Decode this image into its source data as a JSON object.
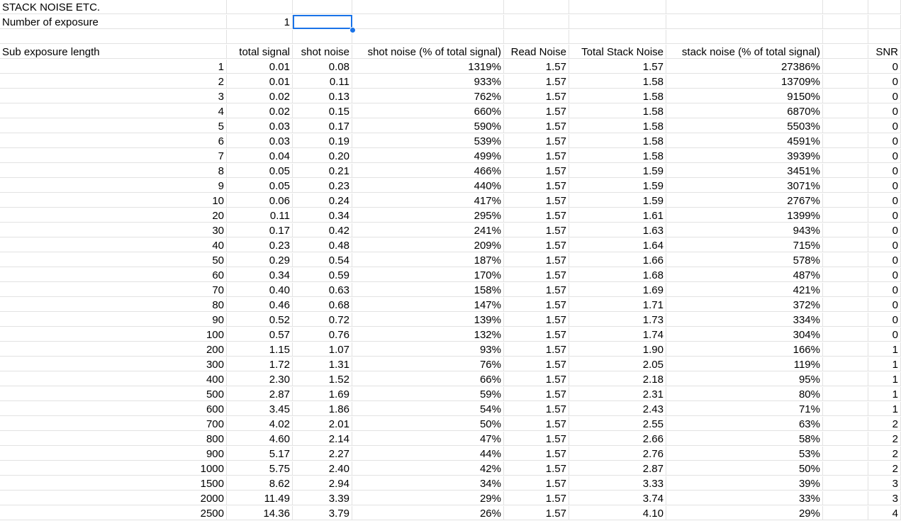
{
  "sheet": {
    "title": "STACK NOISE ETC.",
    "exposure_label": "Number of exposure",
    "exposure_value": "1",
    "selected_cell_value": "",
    "headers": {
      "sub_exposure_length": "Sub exposure length",
      "total_signal": "total signal",
      "shot_noise": "shot noise",
      "shot_noise_pct": "shot noise (% of total signal)",
      "read_noise": "Read Noise",
      "total_stack_noise": "Total Stack Noise",
      "stack_noise_pct": "stack noise (% of total signal)",
      "snr": "SNR"
    },
    "rows": [
      [
        "1",
        "0.01",
        "0.08",
        "1319%",
        "1.57",
        "1.57",
        "27386%",
        "0"
      ],
      [
        "2",
        "0.01",
        "0.11",
        "933%",
        "1.57",
        "1.58",
        "13709%",
        "0"
      ],
      [
        "3",
        "0.02",
        "0.13",
        "762%",
        "1.57",
        "1.58",
        "9150%",
        "0"
      ],
      [
        "4",
        "0.02",
        "0.15",
        "660%",
        "1.57",
        "1.58",
        "6870%",
        "0"
      ],
      [
        "5",
        "0.03",
        "0.17",
        "590%",
        "1.57",
        "1.58",
        "5503%",
        "0"
      ],
      [
        "6",
        "0.03",
        "0.19",
        "539%",
        "1.57",
        "1.58",
        "4591%",
        "0"
      ],
      [
        "7",
        "0.04",
        "0.20",
        "499%",
        "1.57",
        "1.58",
        "3939%",
        "0"
      ],
      [
        "8",
        "0.05",
        "0.21",
        "466%",
        "1.57",
        "1.59",
        "3451%",
        "0"
      ],
      [
        "9",
        "0.05",
        "0.23",
        "440%",
        "1.57",
        "1.59",
        "3071%",
        "0"
      ],
      [
        "10",
        "0.06",
        "0.24",
        "417%",
        "1.57",
        "1.59",
        "2767%",
        "0"
      ],
      [
        "20",
        "0.11",
        "0.34",
        "295%",
        "1.57",
        "1.61",
        "1399%",
        "0"
      ],
      [
        "30",
        "0.17",
        "0.42",
        "241%",
        "1.57",
        "1.63",
        "943%",
        "0"
      ],
      [
        "40",
        "0.23",
        "0.48",
        "209%",
        "1.57",
        "1.64",
        "715%",
        "0"
      ],
      [
        "50",
        "0.29",
        "0.54",
        "187%",
        "1.57",
        "1.66",
        "578%",
        "0"
      ],
      [
        "60",
        "0.34",
        "0.59",
        "170%",
        "1.57",
        "1.68",
        "487%",
        "0"
      ],
      [
        "70",
        "0.40",
        "0.63",
        "158%",
        "1.57",
        "1.69",
        "421%",
        "0"
      ],
      [
        "80",
        "0.46",
        "0.68",
        "147%",
        "1.57",
        "1.71",
        "372%",
        "0"
      ],
      [
        "90",
        "0.52",
        "0.72",
        "139%",
        "1.57",
        "1.73",
        "334%",
        "0"
      ],
      [
        "100",
        "0.57",
        "0.76",
        "132%",
        "1.57",
        "1.74",
        "304%",
        "0"
      ],
      [
        "200",
        "1.15",
        "1.07",
        "93%",
        "1.57",
        "1.90",
        "166%",
        "1"
      ],
      [
        "300",
        "1.72",
        "1.31",
        "76%",
        "1.57",
        "2.05",
        "119%",
        "1"
      ],
      [
        "400",
        "2.30",
        "1.52",
        "66%",
        "1.57",
        "2.18",
        "95%",
        "1"
      ],
      [
        "500",
        "2.87",
        "1.69",
        "59%",
        "1.57",
        "2.31",
        "80%",
        "1"
      ],
      [
        "600",
        "3.45",
        "1.86",
        "54%",
        "1.57",
        "2.43",
        "71%",
        "1"
      ],
      [
        "700",
        "4.02",
        "2.01",
        "50%",
        "1.57",
        "2.55",
        "63%",
        "2"
      ],
      [
        "800",
        "4.60",
        "2.14",
        "47%",
        "1.57",
        "2.66",
        "58%",
        "2"
      ],
      [
        "900",
        "5.17",
        "2.27",
        "44%",
        "1.57",
        "2.76",
        "53%",
        "2"
      ],
      [
        "1000",
        "5.75",
        "2.40",
        "42%",
        "1.57",
        "2.87",
        "50%",
        "2"
      ],
      [
        "1500",
        "8.62",
        "2.94",
        "34%",
        "1.57",
        "3.33",
        "39%",
        "3"
      ],
      [
        "2000",
        "11.49",
        "3.39",
        "29%",
        "1.57",
        "3.74",
        "33%",
        "3"
      ],
      [
        "2500",
        "14.36",
        "3.79",
        "26%",
        "1.57",
        "4.10",
        "29%",
        "4"
      ]
    ]
  },
  "colors": {
    "selection": "#1a73e8",
    "gridline": "#e2e2e2"
  }
}
